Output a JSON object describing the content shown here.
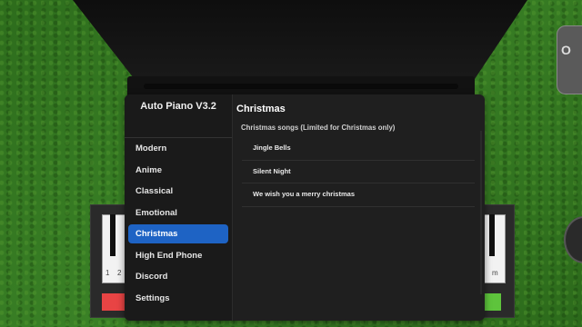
{
  "app": {
    "title": "Auto Piano V3.2",
    "title_prefix": "⠀⠀",
    "title_suffix": "⠀⠀"
  },
  "sidebar": {
    "items": [
      {
        "label": "Modern",
        "active": false
      },
      {
        "label": "Anime",
        "active": false
      },
      {
        "label": "Classical",
        "active": false
      },
      {
        "label": "Emotional",
        "active": false
      },
      {
        "label": "Christmas",
        "active": true
      },
      {
        "label": "High End Phone",
        "active": false
      },
      {
        "label": "Discord",
        "active": false
      },
      {
        "label": "Settings",
        "active": false
      }
    ]
  },
  "content": {
    "section_title": "Christmas",
    "section_subtitle": "Christmas songs (Limited for Christmas only)",
    "songs": [
      {
        "label": "Jingle Bells"
      },
      {
        "label": "Silent Night"
      },
      {
        "label": "We wish you a merry christmas"
      }
    ]
  },
  "background": {
    "key_numbers": [
      "1",
      "2"
    ],
    "right_key_letter": "m",
    "edge_widget_text": "O"
  },
  "colors": {
    "accent": "#1e63c4",
    "red_button": "#e84444",
    "green_button": "#5ec43c"
  }
}
